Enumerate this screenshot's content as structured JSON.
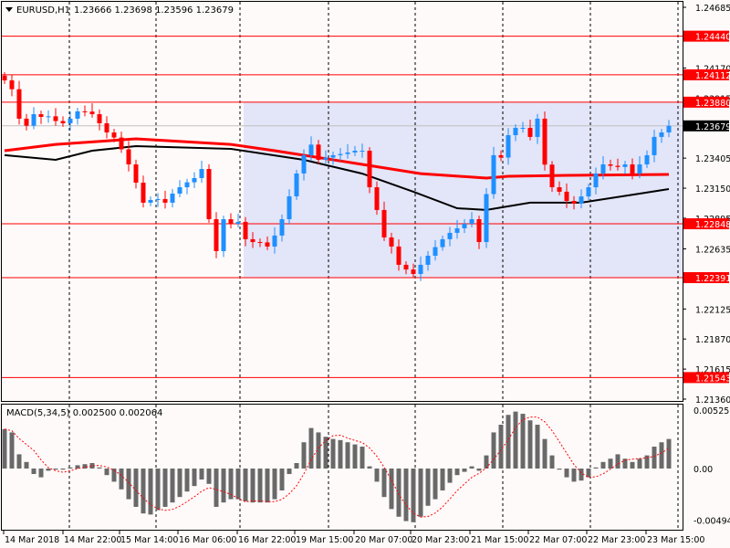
{
  "header": {
    "symbol": "EURUSD,H1",
    "ohlc": "1.23666 1.23698 1.23596 1.23679"
  },
  "colors": {
    "bull": "#1e90ff",
    "bear": "#ff0000",
    "level": "#ff0000",
    "zone": "#e3e5f8",
    "ma_fast": "#ff0000",
    "ma_slow": "#000000",
    "macd_hist": "#696969",
    "macd_signal": "#ff0000"
  },
  "chart_data": [
    {
      "type": "candlestick",
      "title": "EURUSD,H1",
      "ylim": [
        1.2136,
        1.24685
      ],
      "price_ticks": [
        "1.24685",
        "1.24170",
        "1.23915",
        "1.23405",
        "1.23150",
        "1.22895",
        "1.22635",
        "1.22125",
        "1.21870",
        "1.21615",
        "1.21360"
      ],
      "time_labels": [
        "14 Mar 2018",
        "14 Mar 22:00",
        "15 Mar 14:00",
        "16 Mar 06:00",
        "16 Mar 22:00",
        "19 Mar 15:00",
        "20 Mar 07:00",
        "20 Mar 23:00",
        "21 Mar 15:00",
        "22 Mar 07:00",
        "22 Mar 23:00",
        "23 Mar 15:00"
      ],
      "closes": [
        1.24065,
        1.2399,
        1.2374,
        1.2368,
        1.23778,
        1.23755,
        1.2376,
        1.2372,
        1.23701,
        1.2374,
        1.23802,
        1.238,
        1.23778,
        1.23701,
        1.23623,
        1.2358,
        1.2348,
        1.23352,
        1.23197,
        1.23027,
        1.2305,
        1.23058,
        1.23027,
        1.23104,
        1.23158,
        1.232,
        1.23236,
        1.23313,
        1.22887,
        1.22616,
        1.22887,
        1.22848,
        1.22864,
        1.22717,
        1.22693,
        1.2269,
        1.22655,
        1.22748,
        1.22887,
        1.23081,
        1.23275,
        1.2343,
        1.2352,
        1.23391,
        1.2341,
        1.2343,
        1.2344,
        1.23453,
        1.23468,
        1.23468,
        1.23158,
        1.22965,
        1.22732,
        1.22655,
        1.225,
        1.2246,
        1.22422,
        1.225,
        1.22577,
        1.2265,
        1.22717,
        1.22771,
        1.2281,
        1.22848,
        1.22887,
        1.22693,
        1.231,
        1.2343,
        1.2341,
        1.236,
        1.23662,
        1.23662,
        1.23585,
        1.2374,
        1.2335,
        1.23158,
        1.2312,
        1.23042,
        1.2302,
        1.2308,
        1.23158,
        1.23275,
        1.23352,
        1.2334,
        1.2333,
        1.23352,
        1.23275,
        1.23352,
        1.2343,
        1.23585,
        1.23623,
        1.23679
      ],
      "ma_fast": {
        "index": [
          0,
          7,
          18,
          31,
          37,
          49,
          57,
          66,
          69,
          77,
          91
        ],
        "values": [
          1.23468,
          1.23522,
          1.23569,
          1.23522,
          1.23468,
          1.23352,
          1.23274,
          1.23236,
          1.23251,
          1.23259,
          1.23267
        ]
      },
      "ma_slow": {
        "index": [
          0,
          7,
          12,
          18,
          31,
          41,
          49,
          56,
          62,
          66,
          72,
          79,
          87,
          91
        ],
        "values": [
          1.2343,
          1.23391,
          1.23468,
          1.23507,
          1.23484,
          1.23391,
          1.23274,
          1.2312,
          1.2298,
          1.22965,
          1.23027,
          1.23027,
          1.23104,
          1.23143
        ]
      },
      "levels": [
        "1.24440",
        "1.24112",
        "1.23880",
        "1.22848",
        "1.22391",
        "1.21543"
      ],
      "current_price": "1.23679",
      "zone": {
        "from_bar": 32,
        "upper": 1.2388,
        "lower": 1.22391
      }
    },
    {
      "type": "bar",
      "title": "MACD(5,34,5) 0.002500 0.002064",
      "ticks": [
        "0.005253",
        "0.00",
        "-0.004949"
      ],
      "ylim": [
        -0.004949,
        0.005253
      ],
      "histogram": [
        0.0036,
        0.0033,
        0.0013,
        0.0006,
        -0.0005,
        -0.0008,
        -0.0002,
        -0.0001,
        -0.0001,
        0.0001,
        0.0003,
        0.0004,
        0.0005,
        0.0001,
        -0.0006,
        -0.0012,
        -0.0019,
        -0.0028,
        -0.0035,
        -0.0041,
        -0.0042,
        -0.0038,
        -0.0035,
        -0.0031,
        -0.0026,
        -0.0021,
        -0.0016,
        -0.001,
        -0.0014,
        -0.0035,
        -0.0031,
        -0.0028,
        -0.0028,
        -0.003,
        -0.0031,
        -0.0031,
        -0.0031,
        -0.0028,
        -0.002,
        -0.0005,
        0.0005,
        0.0024,
        0.0037,
        0.0033,
        0.0029,
        0.0027,
        0.0026,
        0.0024,
        0.0022,
        0.002,
        0.0002,
        -0.0012,
        -0.0026,
        -0.0037,
        -0.0044,
        -0.0048,
        -0.0049,
        -0.0044,
        -0.0034,
        -0.0028,
        -0.002,
        -0.0013,
        -0.0006,
        -0.0003,
        0.0002,
        -0.0002,
        0.0012,
        0.0033,
        0.004,
        0.0049,
        0.0052,
        0.005,
        0.0044,
        0.004,
        0.0027,
        0.0012,
        -0.0001,
        -0.0008,
        -0.0012,
        -0.0011,
        -0.0008,
        0.0001,
        0.0006,
        0.0009,
        0.0013,
        0.0009,
        0.0006,
        0.0009,
        0.0012,
        0.002,
        0.0024,
        0.0027
      ],
      "signal_period": 5
    }
  ]
}
